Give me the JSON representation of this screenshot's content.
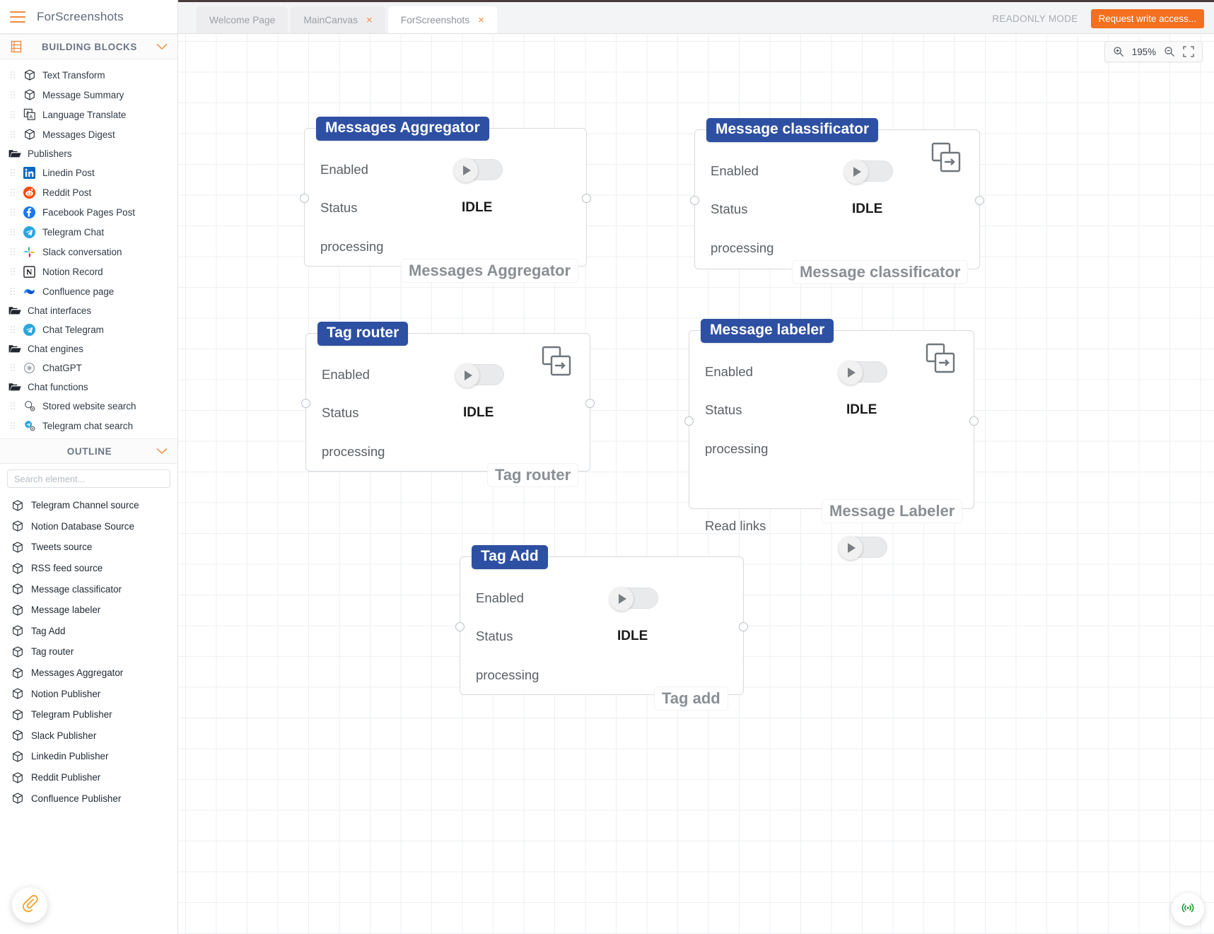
{
  "app": {
    "brand_title": "ForScreenshots",
    "menu_icon": "hamburger-icon"
  },
  "topbar": {
    "tabs": [
      {
        "label": "Welcome Page",
        "closable": false,
        "active": false
      },
      {
        "label": "MainCanvas",
        "closable": true,
        "active": false
      },
      {
        "label": "ForScreenshots",
        "closable": true,
        "active": true
      }
    ],
    "close_glyph": "×",
    "readonly_label": "READONLY MODE",
    "request_access_label": "Request write access...",
    "accent_color": "#f4701f"
  },
  "sidebar": {
    "building_blocks": {
      "title": "BUILDING BLOCKS",
      "icon": "blocks-icon",
      "collapse_icon": "chevron-down-icon",
      "items": [
        {
          "label": "Text Transform",
          "icon": "cube-icon",
          "group": false
        },
        {
          "label": "Message Summary",
          "icon": "cube-icon",
          "group": false
        },
        {
          "label": "Language Translate",
          "icon": "translate-icon",
          "group": false
        },
        {
          "label": "Messages Digest",
          "icon": "cube-icon",
          "group": false
        },
        {
          "label": "Publishers",
          "icon": "folder-icon",
          "group": true
        },
        {
          "label": "Linedin Post",
          "icon": "linkedin-icon",
          "group": false
        },
        {
          "label": "Reddit Post",
          "icon": "reddit-icon",
          "group": false
        },
        {
          "label": "Facebook Pages Post",
          "icon": "facebook-icon",
          "group": false
        },
        {
          "label": "Telegram Chat",
          "icon": "telegram-icon",
          "group": false
        },
        {
          "label": "Slack conversation",
          "icon": "slack-icon",
          "group": false
        },
        {
          "label": "Notion Record",
          "icon": "notion-icon",
          "group": false
        },
        {
          "label": "Confluence page",
          "icon": "confluence-icon",
          "group": false
        },
        {
          "label": "Chat interfaces",
          "icon": "folder-icon",
          "group": true
        },
        {
          "label": "Chat Telegram",
          "icon": "telegram-icon",
          "group": false
        },
        {
          "label": "Chat engines",
          "icon": "folder-icon",
          "group": true
        },
        {
          "label": "ChatGPT",
          "icon": "chatgpt-icon",
          "group": false
        },
        {
          "label": "Chat functions",
          "icon": "folder-icon",
          "group": true
        },
        {
          "label": "Stored website search",
          "icon": "website-search-icon",
          "group": false
        },
        {
          "label": "Telegram chat search",
          "icon": "telegram-search-icon",
          "group": false
        }
      ]
    },
    "outline": {
      "title": "OUTLINE",
      "collapse_icon": "chevron-down-icon",
      "search_placeholder": "Search element...",
      "search_value": "",
      "items": [
        {
          "label": "Telegram Channel source",
          "icon": "cube-icon"
        },
        {
          "label": "Notion Database Source",
          "icon": "cube-icon"
        },
        {
          "label": "Tweets source",
          "icon": "cube-icon"
        },
        {
          "label": "RSS feed source",
          "icon": "cube-icon"
        },
        {
          "label": "Message classificator",
          "icon": "cube-icon"
        },
        {
          "label": "Message labeler",
          "icon": "cube-icon"
        },
        {
          "label": "Tag Add",
          "icon": "cube-icon"
        },
        {
          "label": "Tag router",
          "icon": "cube-icon"
        },
        {
          "label": "Messages Aggregator",
          "icon": "cube-icon"
        },
        {
          "label": "Notion Publisher",
          "icon": "cube-icon"
        },
        {
          "label": "Telegram Publisher",
          "icon": "cube-icon"
        },
        {
          "label": "Slack Publisher",
          "icon": "cube-icon"
        },
        {
          "label": "Linkedin Publisher",
          "icon": "cube-icon"
        },
        {
          "label": "Reddit Publisher",
          "icon": "cube-icon"
        },
        {
          "label": "Confluence Publisher",
          "icon": "cube-icon"
        }
      ]
    },
    "attach_fab_icon": "paperclip-icon"
  },
  "canvas": {
    "zoom": {
      "value": "195%",
      "zoom_in_icon": "zoom-in-icon",
      "zoom_out_icon": "zoom-out-icon",
      "fullscreen_icon": "fullscreen-icon"
    },
    "broadcast_fab_icon": "broadcast-icon",
    "nodes": [
      {
        "id": "messages-aggregator",
        "title": "Messages Aggregator",
        "footer_label": "Messages Aggregator",
        "has_copy_icon": false,
        "rows": [
          {
            "label": "Enabled",
            "type": "toggle",
            "value": ""
          },
          {
            "label": "Status",
            "type": "text",
            "value": "IDLE"
          },
          {
            "label": "processing",
            "type": "plain",
            "value": ""
          }
        ]
      },
      {
        "id": "message-classificator",
        "title": "Message classificator",
        "footer_label": "Message classificator",
        "has_copy_icon": true,
        "rows": [
          {
            "label": "Enabled",
            "type": "toggle",
            "value": ""
          },
          {
            "label": "Status",
            "type": "text",
            "value": "IDLE"
          },
          {
            "label": "processing",
            "type": "plain",
            "value": ""
          }
        ]
      },
      {
        "id": "tag-router",
        "title": "Tag router",
        "footer_label": "Tag router",
        "has_copy_icon": true,
        "rows": [
          {
            "label": "Enabled",
            "type": "toggle",
            "value": ""
          },
          {
            "label": "Status",
            "type": "text",
            "value": "IDLE"
          },
          {
            "label": "processing",
            "type": "plain",
            "value": ""
          }
        ]
      },
      {
        "id": "message-labeler",
        "title": "Message labeler",
        "footer_label": "Message Labeler",
        "has_copy_icon": true,
        "rows": [
          {
            "label": "Enabled",
            "type": "toggle",
            "value": ""
          },
          {
            "label": "Status",
            "type": "text",
            "value": "IDLE"
          },
          {
            "label": "processing",
            "type": "plain",
            "value": ""
          },
          {
            "label": "Read links",
            "type": "toggle",
            "value": ""
          }
        ]
      },
      {
        "id": "tag-add",
        "title": "Tag Add",
        "footer_label": "Tag add",
        "has_copy_icon": false,
        "rows": [
          {
            "label": "Enabled",
            "type": "toggle",
            "value": ""
          },
          {
            "label": "Status",
            "type": "text",
            "value": "IDLE"
          },
          {
            "label": "processing",
            "type": "plain",
            "value": ""
          }
        ]
      }
    ]
  },
  "colors": {
    "node_title_bg": "#2e50a3",
    "accent_orange": "#f4701f",
    "broadcast_green": "#1a9c2e"
  }
}
